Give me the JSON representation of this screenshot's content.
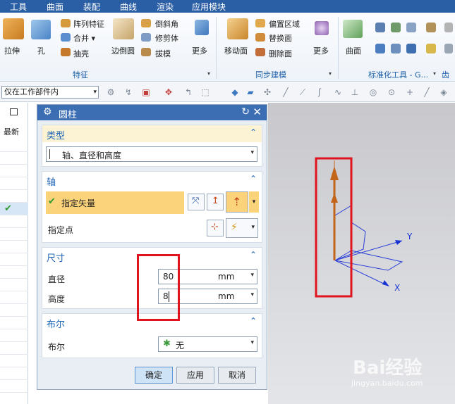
{
  "menu": [
    "工具",
    "曲面",
    "装配",
    "曲线",
    "渲染",
    "应用模块"
  ],
  "ribbon": {
    "group1": {
      "label": "特征",
      "big": [
        "拉伸",
        "孔",
        "边倒圆",
        "更多"
      ],
      "small": [
        "阵列特征",
        "合并",
        "抽壳",
        "倒斜角",
        "修剪体",
        "拔模"
      ]
    },
    "group2": {
      "label": "同步建模",
      "big": [
        "移动面",
        "更多"
      ],
      "small": [
        "偏置区域",
        "替换面",
        "删除面"
      ]
    },
    "group3": {
      "label": "标准化工具 - G...",
      "big": [
        "曲面"
      ]
    },
    "group4": {
      "label": "齿轮"
    }
  },
  "toolbar": {
    "filter": "仅在工作部件内"
  },
  "leftstrip": {
    "header": "最新"
  },
  "dialog": {
    "title": "圆柱",
    "type_section": {
      "title": "类型",
      "value": "轴、直径和高度"
    },
    "axis_section": {
      "title": "轴",
      "vector_label": "指定矢量",
      "point_label": "指定点"
    },
    "size_section": {
      "title": "尺寸",
      "diameter_label": "直径",
      "diameter_value": "80",
      "diameter_unit": "mm",
      "height_label": "高度",
      "height_value": "8",
      "height_unit": "mm"
    },
    "bool_section": {
      "title": "布尔",
      "label": "布尔",
      "value": "无"
    },
    "buttons": {
      "ok": "确定",
      "apply": "应用",
      "cancel": "取消"
    }
  },
  "viewport": {
    "axis_y": "Y",
    "axis_x": "X"
  },
  "watermark": {
    "brand": "Bai经验",
    "url": "jingyan.baidu.com"
  }
}
